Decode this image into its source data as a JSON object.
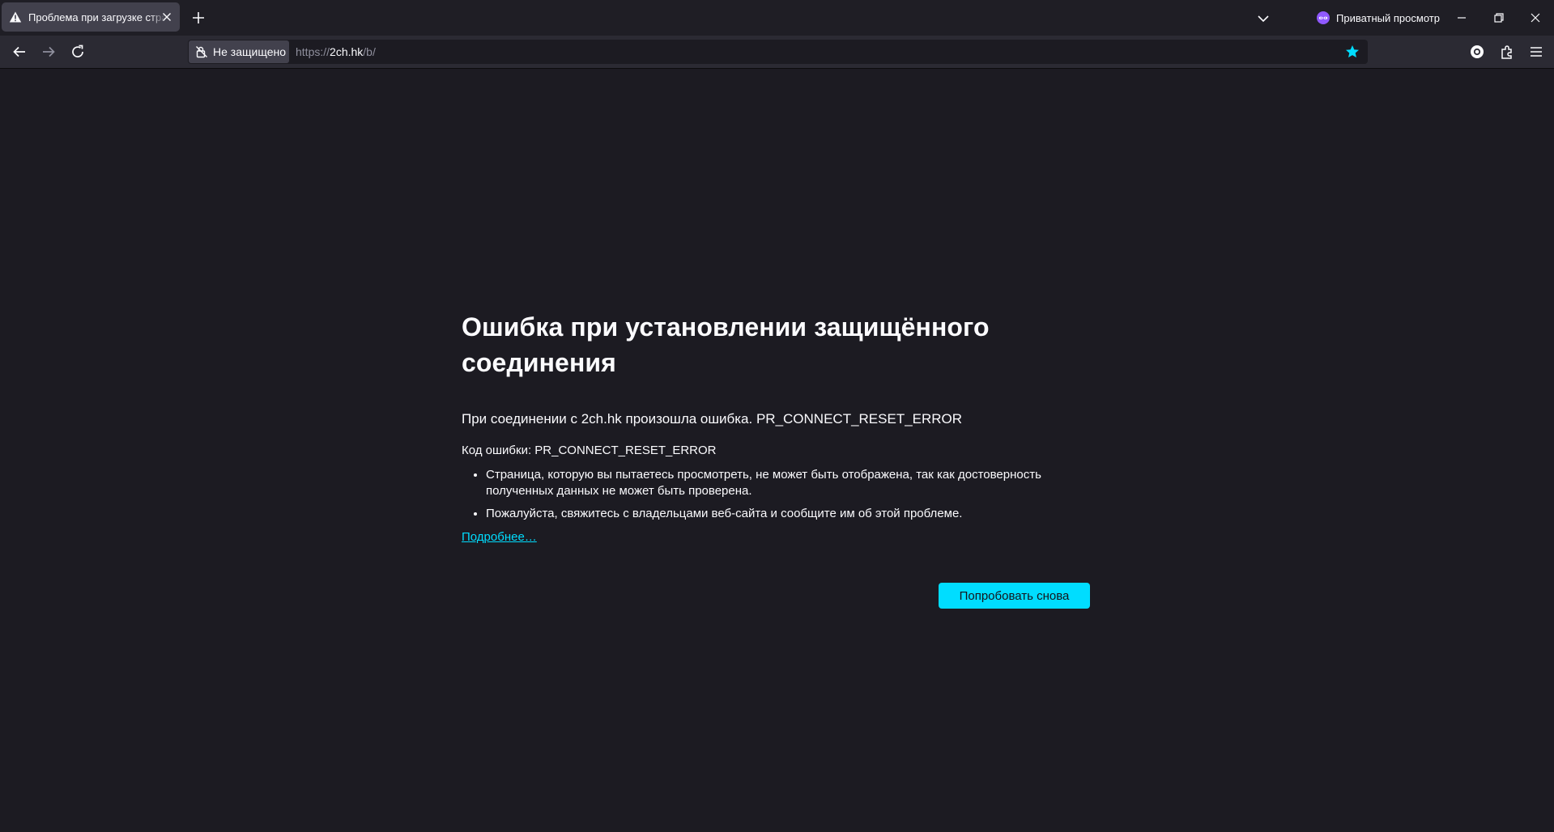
{
  "browser": {
    "tab": {
      "title": "Проблема при загрузке страницы",
      "icon": "warning-icon"
    },
    "private_label": "Приватный просмотр",
    "colors": {
      "accent": "#00ddff",
      "background": "#1c1b22",
      "toolbar": "#2b2a33",
      "tab_active": "#42414d",
      "private": "#9059ff"
    }
  },
  "urlbar": {
    "identity_label": "Не защищено",
    "url_prefix": "https://",
    "url_host": "2ch.hk",
    "url_path": "/b/"
  },
  "error": {
    "title": "Ошибка при установлении защищённого соединения",
    "intro": "При соединении с 2ch.hk произошла ошибка. PR_CONNECT_RESET_ERROR",
    "code": "Код ошибки: PR_CONNECT_RESET_ERROR",
    "bullets": [
      "Страница, которую вы пытаетесь просмотреть, не может быть отображена, так как достоверность полученных данных не может быть проверена.",
      "Пожалуйста, свяжитесь с владельцами веб-сайта и сообщите им об этой проблеме."
    ],
    "more_link": "Подробнее…",
    "retry_button": "Попробовать снова"
  }
}
